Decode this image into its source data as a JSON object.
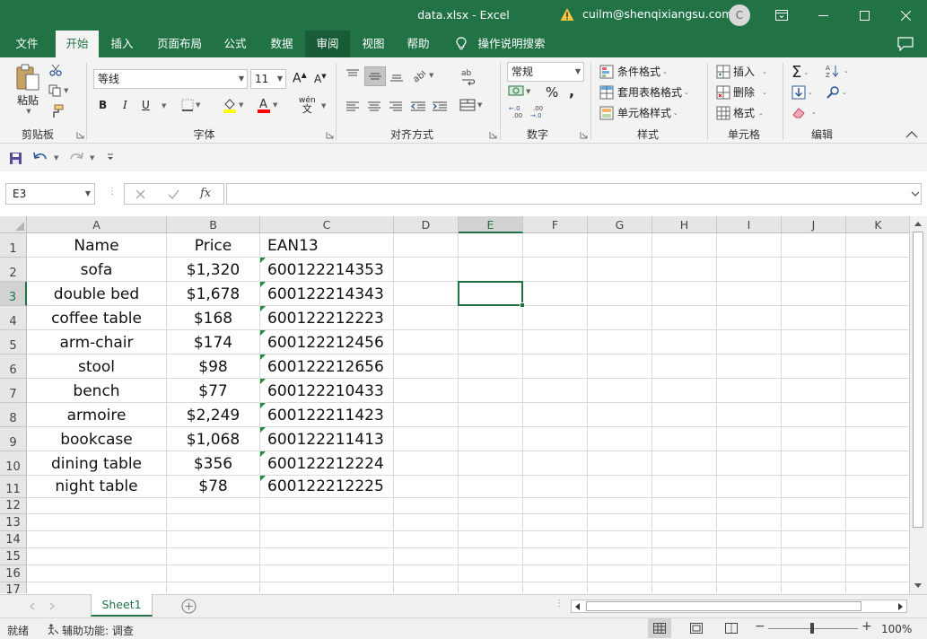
{
  "window": {
    "title": "data.xlsx  -  Excel",
    "user": "cuilm@shenqixiangsu.com",
    "avatar_initial": "C"
  },
  "tabs": [
    "文件",
    "开始",
    "插入",
    "页面布局",
    "公式",
    "数据",
    "审阅",
    "视图",
    "帮助"
  ],
  "tell_me": "操作说明搜索",
  "ribbon": {
    "clipboard": {
      "paste": "粘贴",
      "label": "剪贴板"
    },
    "font": {
      "name": "等线",
      "size": "11",
      "bold": "B",
      "italic": "I",
      "underline": "U",
      "label": "字体",
      "phonetic": "wén"
    },
    "alignment": {
      "label": "对齐方式"
    },
    "number": {
      "format": "常规",
      "percent": "%",
      "comma": ",",
      "label": "数字"
    },
    "styles": {
      "conditional": "条件格式",
      "table": "套用表格格式",
      "cell": "单元格样式",
      "label": "样式"
    },
    "cells": {
      "insert": "插入",
      "delete": "删除",
      "format": "格式",
      "label": "单元格"
    },
    "editing": {
      "label": "编辑"
    }
  },
  "namebox": "E3",
  "formula": "",
  "columns": [
    "A",
    "B",
    "C",
    "D",
    "E",
    "F",
    "G",
    "H",
    "I",
    "J",
    "K"
  ],
  "selected_column": "E",
  "selected_row": 3,
  "rows": [
    "1",
    "2",
    "3",
    "4",
    "5",
    "6",
    "7",
    "8",
    "9",
    "10",
    "11",
    "12",
    "13",
    "14",
    "15",
    "16",
    "17"
  ],
  "table": {
    "headers": [
      "Name",
      "Price",
      "EAN13"
    ],
    "data": [
      [
        "sofa",
        "$1,320",
        "600122214353"
      ],
      [
        "double bed",
        "$1,678",
        "600122214343"
      ],
      [
        "coffee table",
        "$168",
        "600122212223"
      ],
      [
        "arm-chair",
        "$174",
        "600122212456"
      ],
      [
        "stool",
        "$98",
        "600122212656"
      ],
      [
        "bench",
        "$77",
        "600122210433"
      ],
      [
        "armoire",
        "$2,249",
        "600122211423"
      ],
      [
        "bookcase",
        "$1,068",
        "600122211413"
      ],
      [
        "dining table",
        "$356",
        "600122212224"
      ],
      [
        "night table",
        "$78",
        "600122212225"
      ]
    ]
  },
  "sheet_tab": "Sheet1",
  "status": {
    "ready": "就绪",
    "accessibility": "辅助功能: 调查",
    "zoom": "100%"
  },
  "colors": {
    "accent": "#217346",
    "error_indicator": "#218a3c"
  }
}
